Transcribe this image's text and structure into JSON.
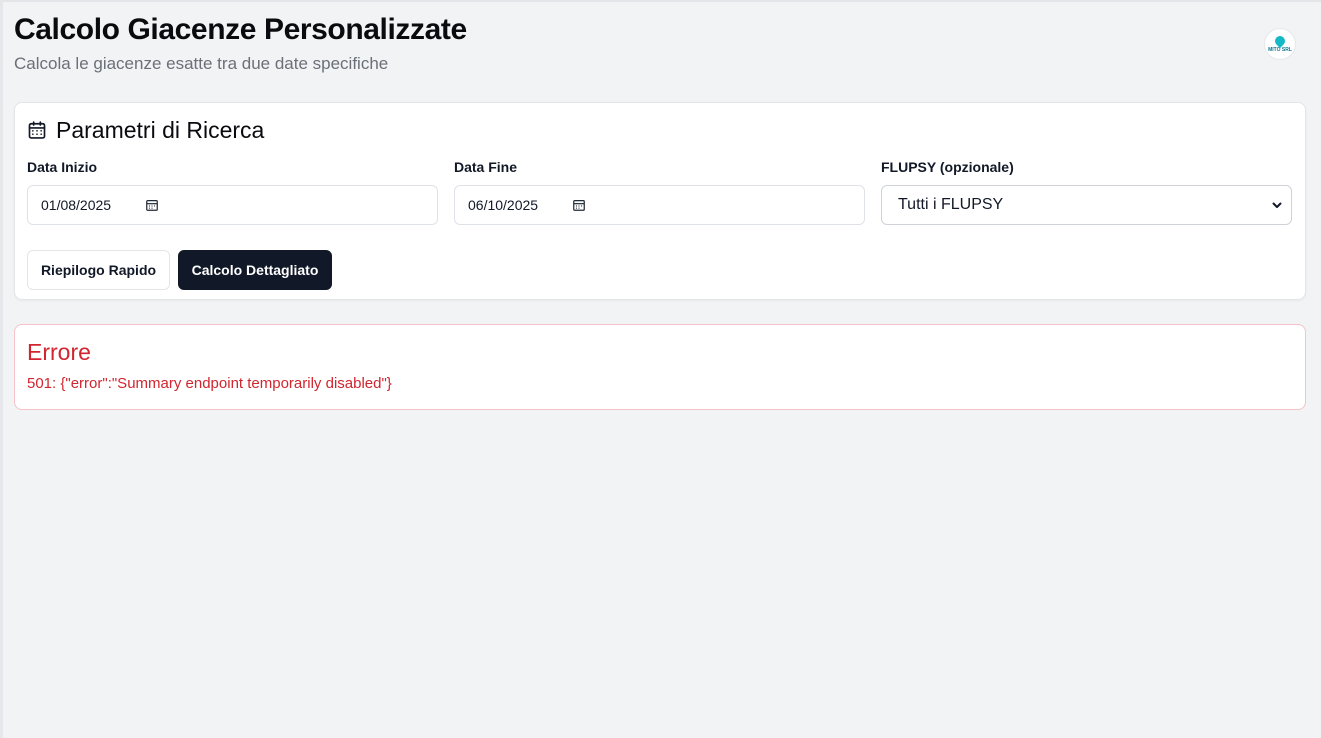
{
  "header": {
    "title": "Calcolo Giacenze Personalizzate",
    "subtitle": "Calcola le giacenze esatte tra due date specifiche",
    "logo_text": "MITO SRL"
  },
  "params": {
    "title": "Parametri di Ricerca",
    "start_date_label": "Data Inizio",
    "start_date_value": "01/08/2025",
    "end_date_label": "Data Fine",
    "end_date_value": "06/10/2025",
    "flupsy_label": "FLUPSY (opzionale)",
    "flupsy_value": "Tutti i FLUPSY",
    "quick_summary_label": "Riepilogo Rapido",
    "detailed_calc_label": "Calcolo Dettagliato"
  },
  "error": {
    "title": "Errore",
    "message": "501: {\"error\":\"Summary endpoint temporarily disabled\"}"
  },
  "colors": {
    "background": "#f2f3f5",
    "primary_button": "#111827",
    "error": "#d1252f",
    "error_border": "#f6c1c7",
    "logo_accent": "#14b8c6"
  }
}
